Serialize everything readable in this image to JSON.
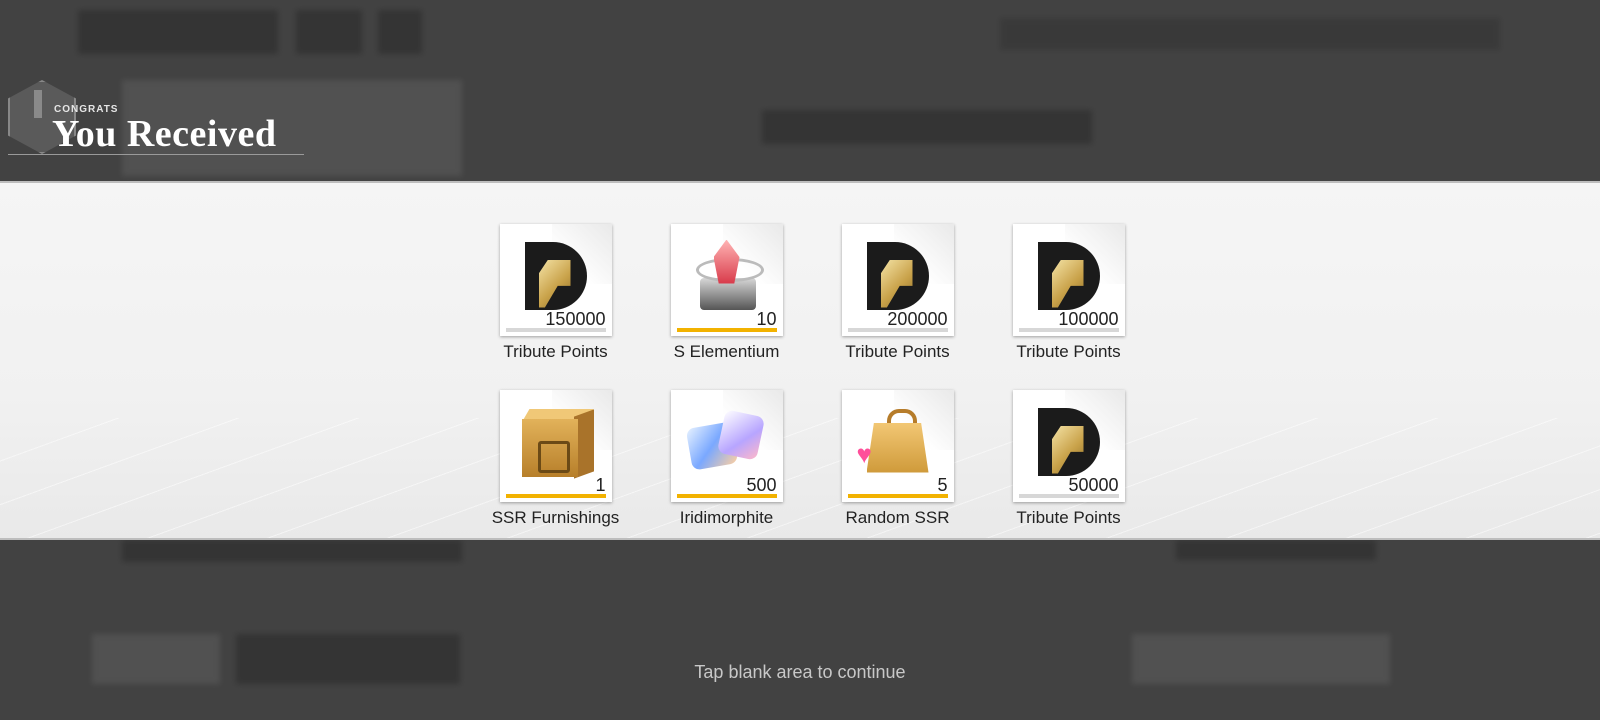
{
  "header": {
    "kicker": "CONGRATS",
    "title": "You Received"
  },
  "rewards": [
    {
      "name": "Tribute Points",
      "quantity": "150000",
      "icon": "tribute-points-icon",
      "bar_color": "#d7d7d7"
    },
    {
      "name": "S Elementium",
      "quantity": "10",
      "icon": "s-elementium-icon",
      "bar_color": "#f2b200"
    },
    {
      "name": "Tribute Points",
      "quantity": "200000",
      "icon": "tribute-points-icon",
      "bar_color": "#d7d7d7"
    },
    {
      "name": "Tribute Points",
      "quantity": "100000",
      "icon": "tribute-points-icon",
      "bar_color": "#d7d7d7"
    },
    {
      "name": "SSR Furnishings",
      "quantity": "1",
      "icon": "ssr-furnishings-box-icon",
      "bar_color": "#f2b200"
    },
    {
      "name": "Iridimorphite",
      "quantity": "500",
      "icon": "iridimorphite-crystal-icon",
      "bar_color": "#f2b200"
    },
    {
      "name": "Random SSR",
      "quantity": "5",
      "icon": "gift-bag-icon",
      "bar_color": "#f2b200"
    },
    {
      "name": "Tribute Points",
      "quantity": "50000",
      "icon": "tribute-points-icon",
      "bar_color": "#d7d7d7"
    }
  ],
  "hint": "Tap blank area to continue"
}
